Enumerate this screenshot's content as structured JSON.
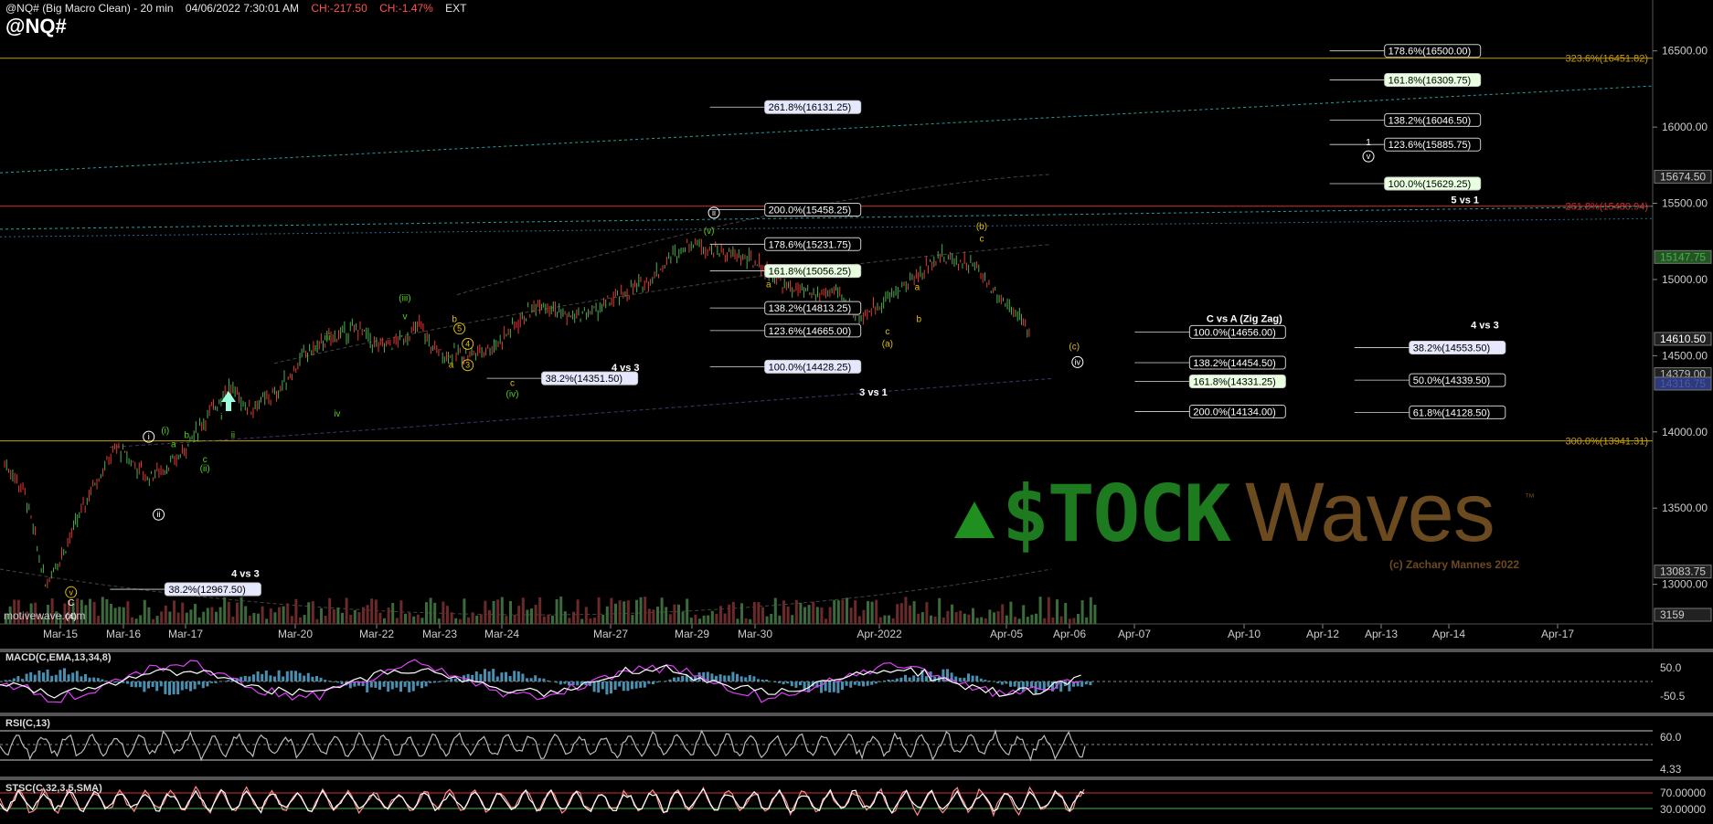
{
  "header": {
    "symbol_desc": "@NQ# (Big Macro Clean) - 20 min",
    "datetime": "04/06/2022 7:30:01 AM",
    "change": "CH:-217.50",
    "change_pct": "CH:-1.47%",
    "session": "EXT",
    "symbol": "@NQ#"
  },
  "watermark": "motivewave.com",
  "logo": {
    "text_left": "$TOCK",
    "text_right": "Waves",
    "tm": "™",
    "copyright": "(c) Zachary Mannes 2022"
  },
  "colors": {
    "up": "#4caf50",
    "down": "#e53935",
    "gold": "#c8a000",
    "teal": "#2a9d9a",
    "red": "#d32f2f",
    "green_lbl": "#58d021",
    "yellow_lbl": "#e0c000",
    "macd": "#e040fb",
    "rsi": "#bbbbbb",
    "stoch": "#ff8a8a"
  },
  "chart_data": [
    {
      "type": "candlestick",
      "title": "@NQ# (Big Macro Clean) - 20 min",
      "x_ticks": [
        "Mar-15",
        "Mar-16",
        "Mar-17",
        "Mar-20",
        "Mar-22",
        "Mar-23",
        "Mar-24",
        "Mar-27",
        "Mar-29",
        "Mar-30",
        "Apr-2022",
        "Apr-05",
        "Apr-06",
        "Apr-07",
        "Apr-10",
        "Apr-12",
        "Apr-13",
        "Apr-14",
        "Apr-17"
      ],
      "y_ticks": [
        "16500.00",
        "16000.00",
        "15500.00",
        "15000.00",
        "14500.00",
        "14000.00",
        "13500.00",
        "13000.00"
      ],
      "ylim": [
        12800,
        16750
      ],
      "price_path": [
        [
          0.0,
          13800
        ],
        [
          0.06,
          13600
        ],
        [
          0.12,
          13000
        ],
        [
          0.18,
          13250
        ],
        [
          0.26,
          13650
        ],
        [
          0.33,
          13900
        ],
        [
          0.42,
          13700
        ],
        [
          0.5,
          13800
        ],
        [
          0.58,
          14050
        ],
        [
          0.66,
          14300
        ],
        [
          0.72,
          14150
        ],
        [
          0.8,
          14250
        ],
        [
          0.88,
          14500
        ],
        [
          0.96,
          14620
        ],
        [
          1.04,
          14680
        ],
        [
          1.1,
          14550
        ],
        [
          1.18,
          14620
        ],
        [
          1.22,
          14700
        ],
        [
          1.26,
          14550
        ],
        [
          1.3,
          14500
        ],
        [
          1.38,
          14520
        ],
        [
          1.44,
          14560
        ],
        [
          1.5,
          14700
        ],
        [
          1.58,
          14860
        ],
        [
          1.66,
          14750
        ],
        [
          1.74,
          14800
        ],
        [
          1.82,
          14900
        ],
        [
          1.9,
          15000
        ],
        [
          1.96,
          15150
        ],
        [
          2.02,
          15250
        ],
        [
          2.08,
          15200
        ],
        [
          2.16,
          15150
        ],
        [
          2.22,
          15100
        ],
        [
          2.3,
          14950
        ],
        [
          2.38,
          14900
        ],
        [
          2.44,
          14920
        ],
        [
          2.52,
          14750
        ],
        [
          2.58,
          14850
        ],
        [
          2.64,
          14950
        ],
        [
          2.7,
          15050
        ],
        [
          2.74,
          15150
        ],
        [
          2.8,
          15130
        ],
        [
          2.86,
          15080
        ],
        [
          2.92,
          14900
        ],
        [
          2.98,
          14780
        ],
        [
          3.02,
          14620
        ]
      ],
      "last_price": "14610.50",
      "price_labels": [
        "15674.50",
        "15147.75",
        "14610.50",
        "14379.00",
        "14316.75",
        "13083.75",
        "3159"
      ],
      "fib_labels": [
        {
          "text": "178.6%(16500.00)",
          "value": 16500,
          "xs": 0.835
        },
        {
          "text": "161.8%(16309.75)",
          "value": 16309.75,
          "xs": 0.835
        },
        {
          "text": "138.2%(16046.50)",
          "value": 16046.5,
          "xs": 0.835
        },
        {
          "text": "123.6%(15885.75)",
          "value": 15885.75,
          "xs": 0.835
        },
        {
          "text": "100.0%(15629.25)",
          "value": 15629.25,
          "xs": 0.835
        },
        {
          "text": "261.8%(16131.25)",
          "value": 16131.25,
          "xs": 0.46
        },
        {
          "text": "200.0%(15458.25)",
          "value": 15458.25,
          "xs": 0.46
        },
        {
          "text": "178.6%(15231.75)",
          "value": 15231.75,
          "xs": 0.46
        },
        {
          "text": "161.8%(15056.25)",
          "value": 15056.25,
          "xs": 0.46
        },
        {
          "text": "138.2%(14813.25)",
          "value": 14813.25,
          "xs": 0.46
        },
        {
          "text": "123.6%(14665.00)",
          "value": 14665,
          "xs": 0.46
        },
        {
          "text": "100.0%(14428.25)",
          "value": 14428.25,
          "xs": 0.46
        },
        {
          "text": "38.2%(14351.50)",
          "value": 14351.5,
          "xs": 0.325
        },
        {
          "text": "38.2%(12967.50)",
          "value": 12967.5,
          "xs": 0.097
        },
        {
          "text": "100.0%(14656.00)",
          "value": 14656,
          "xs": 0.717
        },
        {
          "text": "138.2%(14454.50)",
          "value": 14454.5,
          "xs": 0.717
        },
        {
          "text": "161.8%(14331.25)",
          "value": 14331.25,
          "xs": 0.717
        },
        {
          "text": "200.0%(14134.00)",
          "value": 14134,
          "xs": 0.717
        },
        {
          "text": "38.2%(14553.50)",
          "value": 14553.5,
          "xs": 0.85
        },
        {
          "text": "50.0%(14339.50)",
          "value": 14339.5,
          "xs": 0.85
        },
        {
          "text": "61.8%(14128.50)",
          "value": 14128.5,
          "xs": 0.85
        }
      ],
      "level_lines": [
        {
          "text": "323.6%(16451.82)",
          "value": 16451.82,
          "color": "gold"
        },
        {
          "text": "261.8%(15480.94)",
          "value": 15480.94,
          "color": "red"
        },
        {
          "text": "300.0%(13941.31)",
          "value": 13941.31,
          "color": "gold"
        }
      ],
      "annotations": [
        {
          "text": "5 vs 1",
          "value": 15500,
          "xs": 0.878
        },
        {
          "text": "C vs A (Zig Zag)",
          "value": 14720,
          "xs": 0.73
        },
        {
          "text": "4 vs 3",
          "value": 14680,
          "xs": 0.89
        },
        {
          "text": "4 vs 3",
          "value": 14400,
          "xs": 0.37
        },
        {
          "text": "3 vs 1",
          "value": 14240,
          "xs": 0.52
        },
        {
          "text": "4 vs 3",
          "value": 13050,
          "xs": 0.14
        }
      ],
      "wave_labels": [
        {
          "text": "(i)",
          "xs": 0.1,
          "value": 13990,
          "c": "g"
        },
        {
          "text": "b",
          "xs": 0.113,
          "value": 13960,
          "c": "g"
        },
        {
          "text": "a",
          "xs": 0.105,
          "value": 13900,
          "c": "g"
        },
        {
          "text": "i",
          "xs": 0.134,
          "value": 14080,
          "c": "g"
        },
        {
          "text": "c",
          "xs": 0.124,
          "value": 13800,
          "c": "g"
        },
        {
          "text": "(ii)",
          "xs": 0.124,
          "value": 13740,
          "c": "g"
        },
        {
          "text": "ii",
          "xs": 0.141,
          "value": 13960,
          "c": "g"
        },
        {
          "text": "iii",
          "xs": 0.198,
          "value": 14600,
          "c": "g"
        },
        {
          "text": "iv",
          "xs": 0.204,
          "value": 14100,
          "c": "g"
        },
        {
          "text": "(iii)",
          "xs": 0.245,
          "value": 14860,
          "c": "g"
        },
        {
          "text": "v",
          "xs": 0.245,
          "value": 14740,
          "c": "g"
        },
        {
          "text": "(iv)",
          "xs": 0.31,
          "value": 14230,
          "c": "g"
        },
        {
          "text": "b",
          "xs": 0.275,
          "value": 14720,
          "c": "y"
        },
        {
          "text": "a",
          "xs": 0.273,
          "value": 14420,
          "c": "y"
        },
        {
          "text": "c",
          "xs": 0.31,
          "value": 14300,
          "c": "y"
        },
        {
          "text": "(v)",
          "xs": 0.429,
          "value": 15300,
          "c": "g"
        },
        {
          "text": "a",
          "xs": 0.465,
          "value": 14950,
          "c": "y"
        },
        {
          "text": "a",
          "xs": 0.555,
          "value": 14930,
          "c": "y"
        },
        {
          "text": "b",
          "xs": 0.556,
          "value": 14720,
          "c": "y"
        },
        {
          "text": "c",
          "xs": 0.537,
          "value": 14640,
          "c": "y"
        },
        {
          "text": "(a)",
          "xs": 0.537,
          "value": 14560,
          "c": "y"
        },
        {
          "text": "(b)",
          "xs": 0.594,
          "value": 15330,
          "c": "y"
        },
        {
          "text": "c",
          "xs": 0.594,
          "value": 15250,
          "c": "y"
        },
        {
          "text": "(c)",
          "xs": 0.65,
          "value": 14540,
          "c": "y"
        },
        {
          "text": "C",
          "xs": 0.043,
          "value": 12860,
          "c": "w"
        },
        {
          "text": "(4)",
          "xs": 0.043,
          "value": 12770,
          "c": "w"
        },
        {
          "text": "1",
          "xs": 0.828,
          "value": 15880,
          "c": "w"
        }
      ],
      "circle_labels": [
        {
          "text": "i",
          "xs": 0.09,
          "value": 13950,
          "c": "w"
        },
        {
          "text": "ii",
          "xs": 0.096,
          "value": 13440,
          "c": "w"
        },
        {
          "text": "v",
          "xs": 0.043,
          "value": 12930,
          "c": "y"
        },
        {
          "text": "ii",
          "xs": 0.432,
          "value": 15420,
          "c": "w"
        },
        {
          "text": "iv",
          "xs": 0.652,
          "value": 14440,
          "c": "w"
        },
        {
          "text": "v",
          "xs": 0.828,
          "value": 15790,
          "c": "w"
        },
        {
          "text": "5",
          "xs": 0.278,
          "value": 14660,
          "c": "y"
        },
        {
          "text": "4",
          "xs": 0.283,
          "value": 14560,
          "c": "y"
        },
        {
          "text": "3",
          "xs": 0.283,
          "value": 14420,
          "c": "y"
        }
      ]
    },
    {
      "type": "line",
      "title": "MACD(C,EMA,13,34,8)",
      "y_ticks": [
        "50.0",
        "-50.5"
      ]
    },
    {
      "type": "line",
      "title": "RSI(C,13)",
      "y_ticks": [
        "60.0",
        "4.33"
      ]
    },
    {
      "type": "line",
      "title": "STSC(C,32,3,5,SMA)",
      "y_ticks": [
        "70.00000",
        "30.00000"
      ]
    }
  ]
}
